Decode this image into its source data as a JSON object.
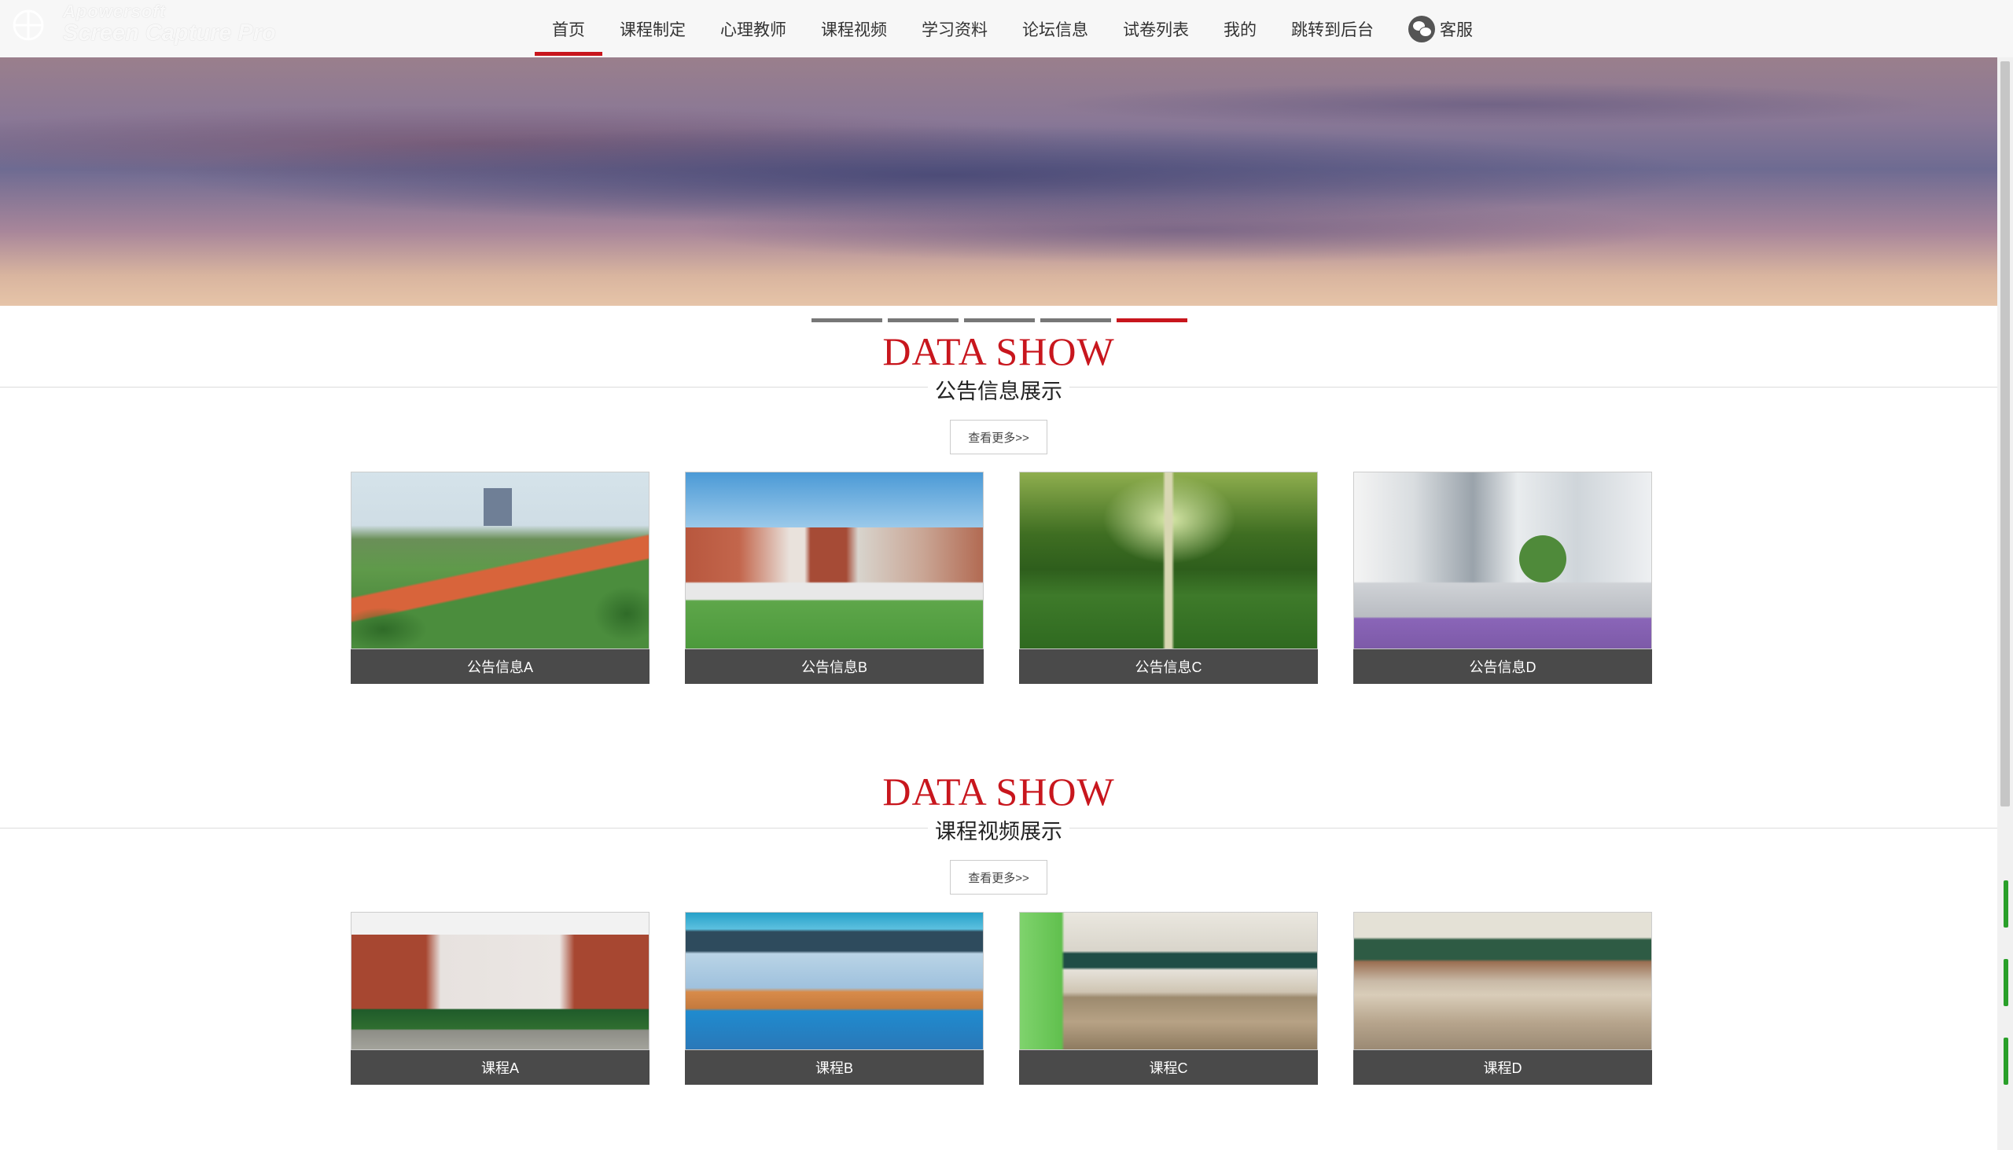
{
  "watermark": {
    "brand": "Apowersoft",
    "product": "Screen Capture Pro"
  },
  "nav": {
    "items": [
      {
        "label": "首页",
        "active": true
      },
      {
        "label": "课程制定"
      },
      {
        "label": "心理教师"
      },
      {
        "label": "课程视频"
      },
      {
        "label": "学习资料"
      },
      {
        "label": "论坛信息"
      },
      {
        "label": "试卷列表"
      },
      {
        "label": "我的"
      },
      {
        "label": "跳转到后台"
      }
    ],
    "service": {
      "label": "客服",
      "icon": "wechat-icon"
    }
  },
  "banner": {
    "slide_count": 5,
    "active_slide": 5
  },
  "sections": [
    {
      "title": "DATA SHOW",
      "subtitle": "公告信息展示",
      "more_label": "查看更多>>",
      "cards": [
        {
          "caption": "公告信息A"
        },
        {
          "caption": "公告信息B"
        },
        {
          "caption": "公告信息C"
        },
        {
          "caption": "公告信息D"
        }
      ]
    },
    {
      "title": "DATA SHOW",
      "subtitle": "课程视频展示",
      "more_label": "查看更多>>",
      "cards": [
        {
          "caption": "课程A"
        },
        {
          "caption": "课程B"
        },
        {
          "caption": "课程C"
        },
        {
          "caption": "课程D"
        }
      ]
    }
  ],
  "colors": {
    "accent": "#c8161d",
    "caption_bg": "#4a4a4a",
    "nav_bg": "#f7f7f7"
  }
}
